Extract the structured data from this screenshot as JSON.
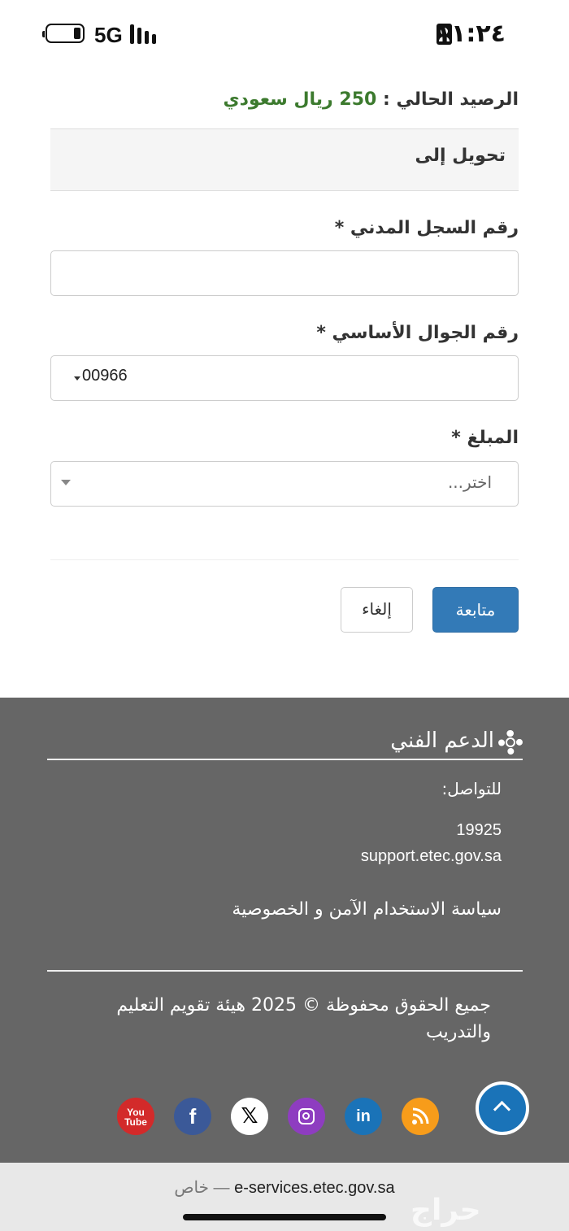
{
  "status_bar": {
    "network": "5G",
    "time": "١١:٢٤"
  },
  "form": {
    "balance_label": "الرصيد الحالي :",
    "balance_value": "250 ريال سعودي",
    "section_title": "تحويل إلى",
    "national_id_label": "رقم السجل المدني *",
    "national_id_value": "",
    "mobile_label": "رقم الجوال الأساسي *",
    "mobile_country_code": "00966",
    "amount_label": "المبلغ *",
    "amount_placeholder": "اختر...",
    "continue_label": "متابعة",
    "cancel_label": "إلغاء"
  },
  "footer": {
    "support_title": "الدعم الفني",
    "contact_label": "للتواصل:",
    "phone": "19925",
    "email": "support.etec.gov.sa",
    "privacy_link": "سياسة الاستخدام الآمن و الخصوصية",
    "copyright": "جميع الحقوق محفوظة © 2025 هيئة تقويم التعليم والتدريب",
    "social": [
      {
        "name": "youtube",
        "glyph": "You\nTube",
        "color": "#d32a2a"
      },
      {
        "name": "facebook",
        "glyph": "f",
        "color": "#3b5998"
      },
      {
        "name": "x",
        "glyph": "𝕏",
        "color": "#ffffff"
      },
      {
        "name": "instagram",
        "color": "#8e3dc0"
      },
      {
        "name": "linkedin",
        "glyph": "in",
        "color": "#1a73b8"
      },
      {
        "name": "rss",
        "color": "#f79c1a"
      }
    ]
  },
  "browser": {
    "url": "e-services.etec.gov.sa",
    "mode_label": "خاص —"
  },
  "watermark": "حراج",
  "colors": {
    "accent": "#337ab7",
    "balance": "#3c7a2e",
    "footer_bg": "#666666"
  }
}
